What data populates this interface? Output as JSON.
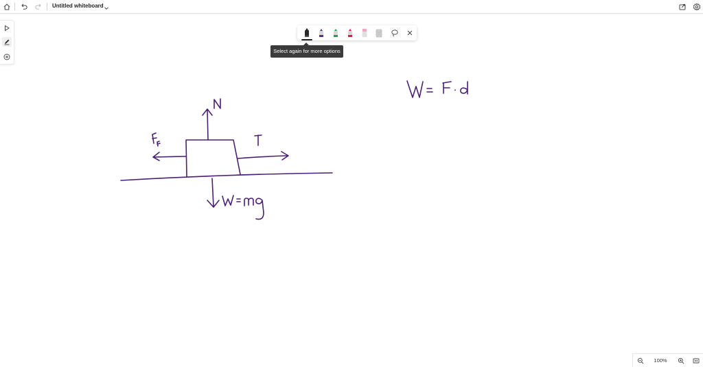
{
  "header": {
    "title": "Untitled whiteboard",
    "icons": [
      "home-icon",
      "undo-icon",
      "redo-icon",
      "chevron-down-icon",
      "share-icon",
      "settings-icon"
    ]
  },
  "left_tools": [
    "select-icon",
    "pen-icon",
    "add-icon"
  ],
  "pen_toolbar": {
    "pens": [
      {
        "name": "black",
        "color": "#1f1f1f",
        "selected": true
      },
      {
        "name": "purple",
        "color": "#5b2d8e",
        "selected": false
      },
      {
        "name": "green",
        "color": "#1f9d55",
        "selected": false
      },
      {
        "name": "red",
        "color": "#d61f4a",
        "selected": false
      },
      {
        "name": "highlighter-pink",
        "color": "#f4a6c0",
        "selected": false
      },
      {
        "name": "eraser",
        "color": "#bfbfbf",
        "selected": false
      }
    ],
    "icons": [
      "lasso-icon",
      "close-icon"
    ]
  },
  "tooltip": "Select again for more options",
  "ink_color": "#4b1f74",
  "zoom": {
    "level": "100%",
    "icons": [
      "zoom-out-icon",
      "zoom-in-icon",
      "fit-screen-icon"
    ]
  }
}
